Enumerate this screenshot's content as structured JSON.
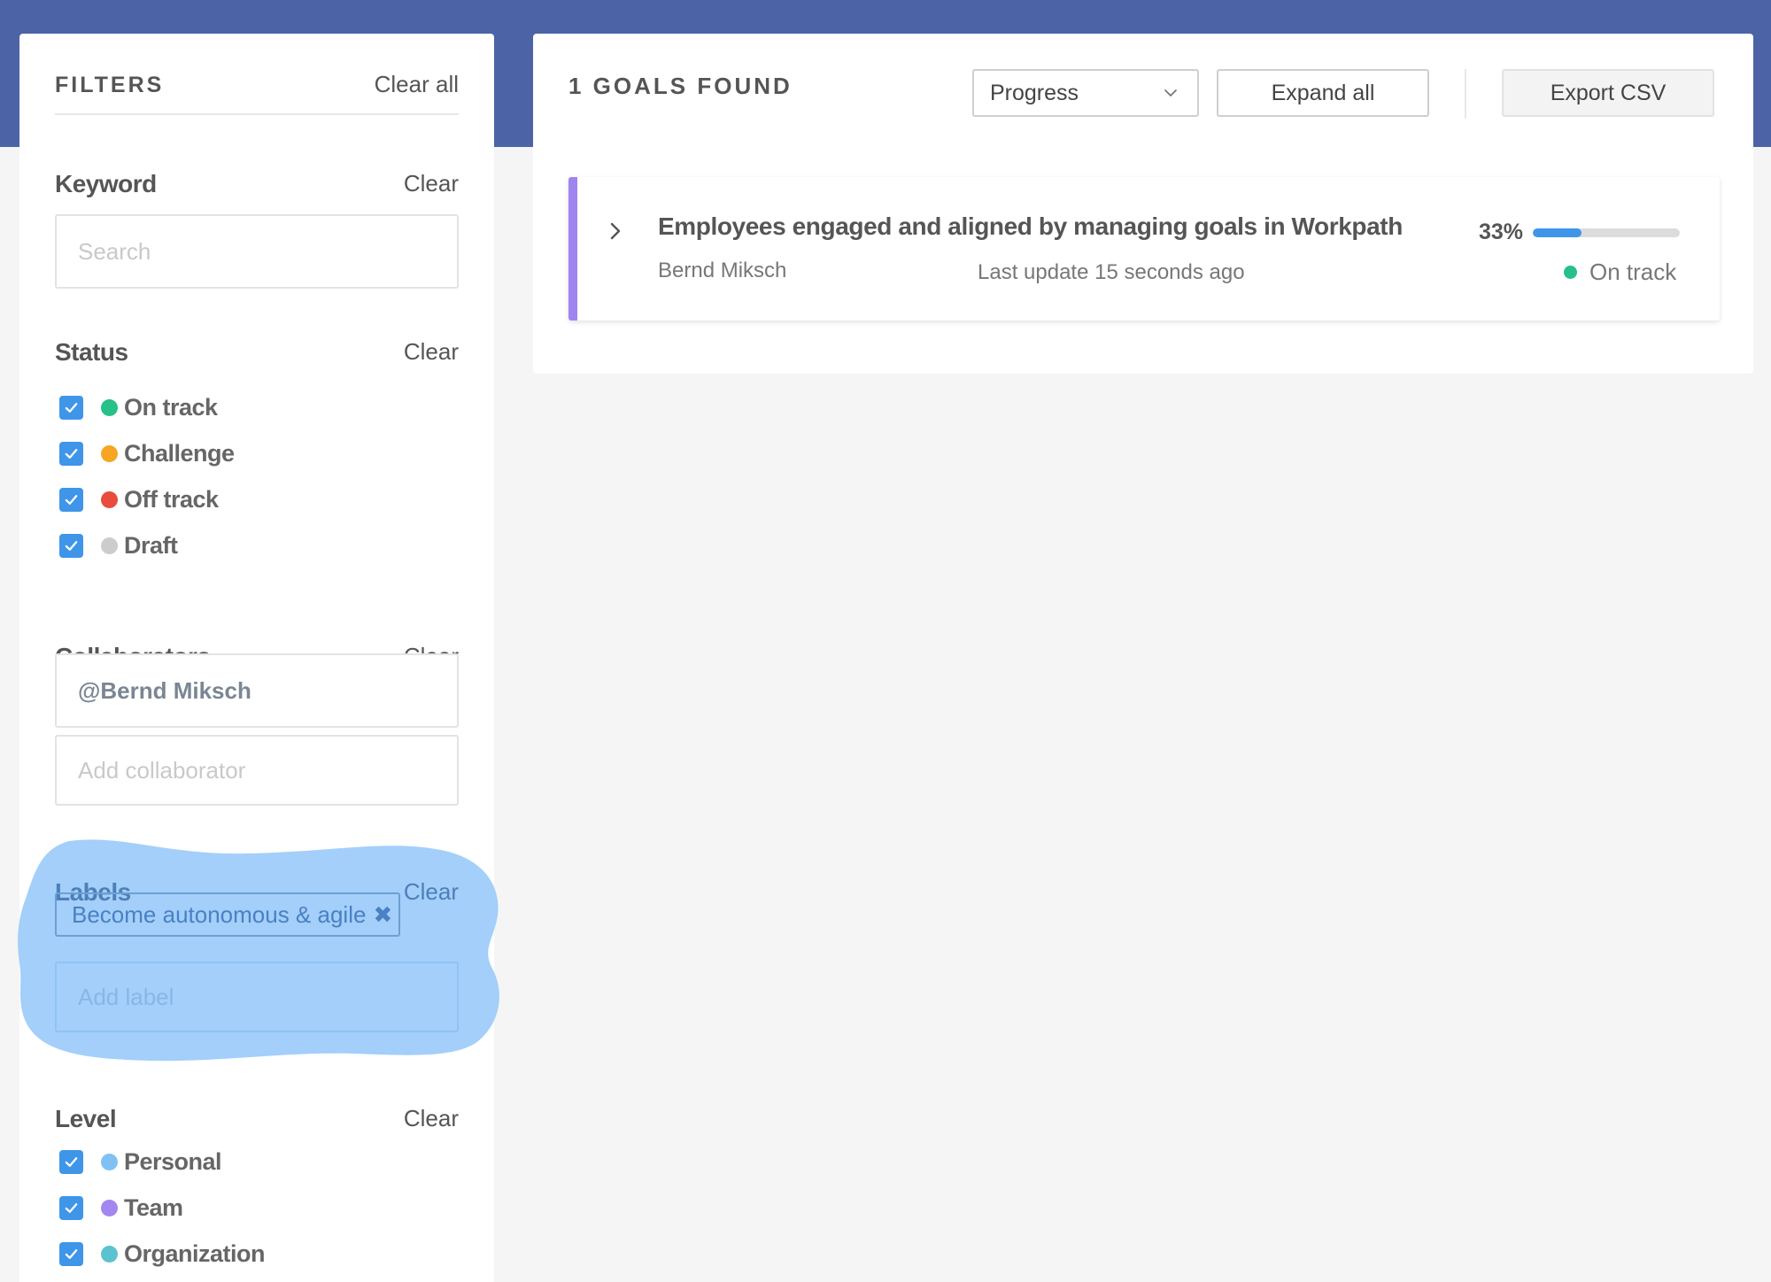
{
  "filters": {
    "title": "FILTERS",
    "clear_all": "Clear all",
    "clear_label": "Clear",
    "keyword": {
      "title": "Keyword",
      "placeholder": "Search"
    },
    "status": {
      "title": "Status",
      "items": [
        {
          "label": "On track",
          "color": "#26c089",
          "checked": true
        },
        {
          "label": "Challenge",
          "color": "#f5a623",
          "checked": true
        },
        {
          "label": "Off track",
          "color": "#e74c3c",
          "checked": true
        },
        {
          "label": "Draft",
          "color": "#cccccc",
          "checked": true
        }
      ]
    },
    "collaborators": {
      "title": "Collaborators",
      "value": "@Bernd Miksch",
      "placeholder": "Add collaborator"
    },
    "labels": {
      "title": "Labels",
      "chip": "Become autonomous & agile",
      "chip_remove": "✖",
      "placeholder": "Add label",
      "highlight_color": "#a3cffa"
    },
    "level": {
      "title": "Level",
      "items": [
        {
          "label": "Personal",
          "color": "#7fc1f4",
          "checked": true
        },
        {
          "label": "Team",
          "color": "#a486f0",
          "checked": true
        },
        {
          "label": "Organization",
          "color": "#5bc3cf",
          "checked": true
        }
      ]
    }
  },
  "main": {
    "title": "1 GOALS FOUND",
    "sort_select": "Progress",
    "expand_all": "Expand all",
    "export_csv": "Export CSV",
    "goals": [
      {
        "title": "Employees engaged and aligned by managing goals in Workpath",
        "owner": "Bernd Miksch",
        "updated": "Last update 15 seconds ago",
        "progress_label": "33%",
        "progress": 0.33,
        "status": "On track",
        "status_color": "#26c089",
        "stripe_color": "#a084f0"
      }
    ]
  },
  "colors": {
    "header": "#4c64a6",
    "accent": "#3f95e8"
  }
}
